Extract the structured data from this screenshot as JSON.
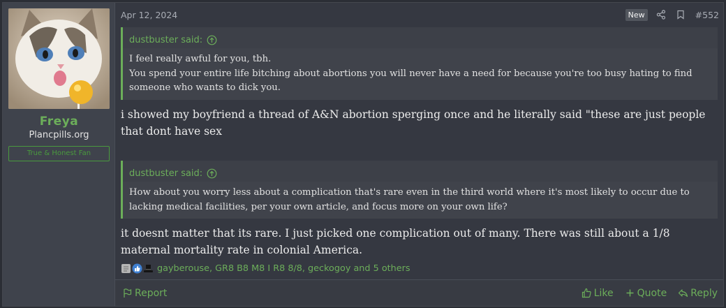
{
  "user": {
    "name": "Freya",
    "site": "Plancpills.org",
    "banner": "True & Honest Fan"
  },
  "post": {
    "date": "Apr 12, 2024",
    "badge": "New",
    "number": "#552"
  },
  "quotes": [
    {
      "author": "dustbuster said:",
      "lines": [
        "I feel really awful for you, tbh.",
        "You spend your entire life bitching about abortions you will never have a need for because you're too busy hating to find someone who wants to dick you."
      ]
    },
    {
      "author": "dustbuster said:",
      "lines": [
        "How about you worry less about a complication that's rare even in the third world where it's most likely to occur due to lacking medical facilities, per your own article, and focus more on your own life?"
      ]
    }
  ],
  "replies": [
    "i showed my boyfriend a thread of A&N abortion sperging once and he literally said \"these are just people that dont have sex",
    "it doesnt matter that its rare. I just picked one complication out of many. There was still about a 1/8 maternal mortality rate in colonial America."
  ],
  "reactions": {
    "icons": [
      "sticky-note-icon",
      "thumbs-up-icon",
      "top-hat-icon"
    ],
    "text": "gayberouse, GR8 B8 M8 I R8 8/8, geckogoy and 5 others"
  },
  "footer": {
    "report": "Report",
    "like": "Like",
    "quote": "Quote",
    "reply": "Reply"
  },
  "colors": {
    "accent": "#6cae5a",
    "background": "#353841",
    "user_column": "#3f434c"
  }
}
